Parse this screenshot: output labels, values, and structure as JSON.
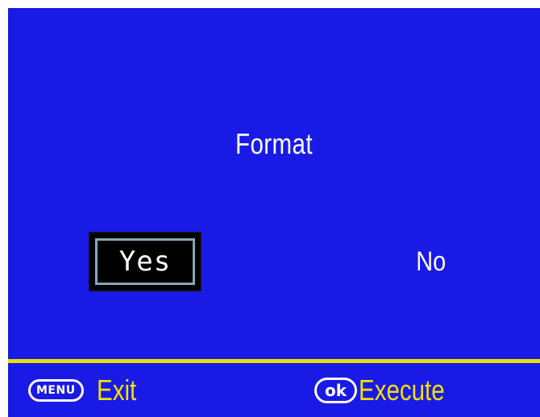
{
  "dialog": {
    "title": "Format",
    "options": {
      "yes_label": "Yes",
      "no_label": "No",
      "selected": "Yes"
    }
  },
  "footer": {
    "menu_key_label": "MENU",
    "menu_action_label": "Exit",
    "ok_key_label": "ok",
    "ok_action_label": "Execute"
  },
  "colors": {
    "background": "#1a1ae6",
    "highlight_text": "#f0e000",
    "text": "#ffffff",
    "selection_border": "#87a6b8",
    "divider": "#e8e000"
  }
}
